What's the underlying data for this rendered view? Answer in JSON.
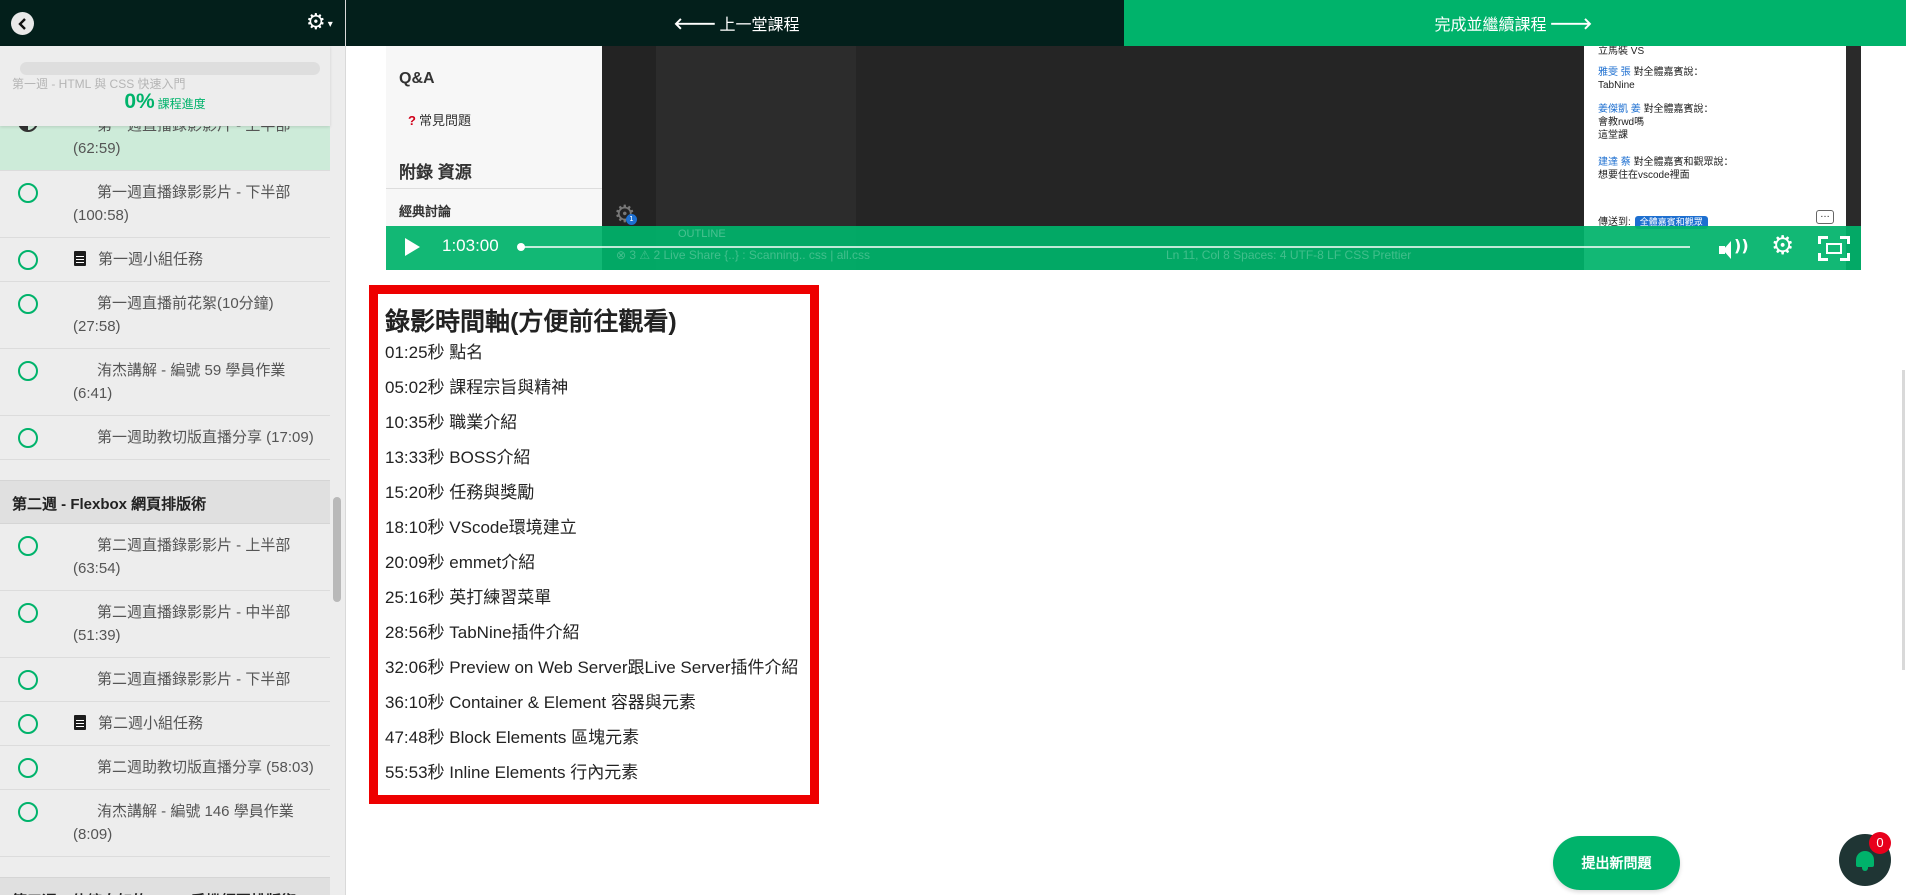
{
  "sidebar": {
    "progress": {
      "percent": "0%",
      "label": "課程進度",
      "value": 0
    },
    "ghost_week": "第一週 - HTML 與 CSS 快速入門",
    "week1_items": [
      {
        "title": "第一週直播錄影影片 - 上半部 (62:59)",
        "type": "video",
        "active": true
      },
      {
        "title": "第一週直播錄影影片 - 下半部 (100:58)",
        "type": "video"
      },
      {
        "title": "第一週小組任務",
        "type": "doc"
      },
      {
        "title": "第一週直播前花絮(10分鐘) (27:58)",
        "type": "video"
      },
      {
        "title": "洧杰講解 - 編號 59 學員作業 (6:41)",
        "type": "video"
      },
      {
        "title": "第一週助教切版直播分享 (17:09)",
        "type": "video"
      }
    ],
    "week2_title": "第二週 - Flexbox 網頁排版術",
    "week2_items": [
      {
        "title": "第二週直播錄影影片 - 上半部 (63:54)",
        "type": "video"
      },
      {
        "title": "第二週直播錄影影片 - 中半部 (51:39)",
        "type": "video"
      },
      {
        "title": "第二週直播錄影影片 - 下半部",
        "type": "video"
      },
      {
        "title": "第二週小組任務",
        "type": "doc"
      },
      {
        "title": "第二週助教切版直播分享 (58:03)",
        "type": "video"
      },
      {
        "title": "洧杰講解 - 編號 146 學員作業 (8:09)",
        "type": "video"
      }
    ],
    "week3_title": "第三週：伸縮自如的 RWD 手機網頁排版術"
  },
  "nav": {
    "prev_label": "上一堂課程",
    "next_label": "完成並繼續課程"
  },
  "video": {
    "time": "1:03:00",
    "progress_fraction": 0.0,
    "left_panel": {
      "qa": "Q&A",
      "faq": "常見問題",
      "appendix": "附錄 資源",
      "classic": "經典討論"
    },
    "chat": [
      {
        "name": "",
        "text": "立馬裝 VS"
      },
      {
        "name": "雅雯 張",
        "suffix": "對全體嘉賓說：",
        "text": "TabNine"
      },
      {
        "name": "姜傑凱 姜",
        "suffix": "對全體嘉賓說：",
        "text": "會教rwd嗎\n這堂課"
      },
      {
        "name": "建達 蔡",
        "suffix": "對全體嘉賓和觀眾說：",
        "text": "想要住在vscode裡面"
      }
    ],
    "chat_send_to": "傳送到:",
    "chat_target": "全體嘉賓和觀眾",
    "status_ghost": "Ln 11, Col 8   Spaces: 4   UTF-8   LF   CSS   Prettier",
    "outline_ghost": "OUTLINE",
    "live_share_ghost": "⊗ 3 ⚠ 2   Live Share   {..} : Scanning..   css | all.css"
  },
  "timeline": {
    "title": "錄影時間軸(方便前往觀看)",
    "entries": [
      "01:25秒 點名",
      "05:02秒 課程宗旨與精神",
      "10:35秒 職業介紹",
      "13:33秒 BOSS介紹",
      "15:20秒 任務與獎勵",
      "18:10秒 VScode環境建立",
      "20:09秒 emmet介紹",
      "25:16秒 英打練習菜單",
      "28:56秒 TabNine插件介紹",
      "32:06秒 Preview on Web Server跟Live Server插件介紹",
      "36:10秒 Container & Element 容器與元素",
      "47:48秒 Block Elements 區塊元素",
      "55:53秒 Inline Elements 行內元素"
    ]
  },
  "actions": {
    "ask_label": "提出新問題",
    "notification_count": "0"
  },
  "colors": {
    "accent": "#00b36b",
    "dark": "#031f1b",
    "highlight_border": "#ee0000",
    "badge": "#e8001c"
  }
}
